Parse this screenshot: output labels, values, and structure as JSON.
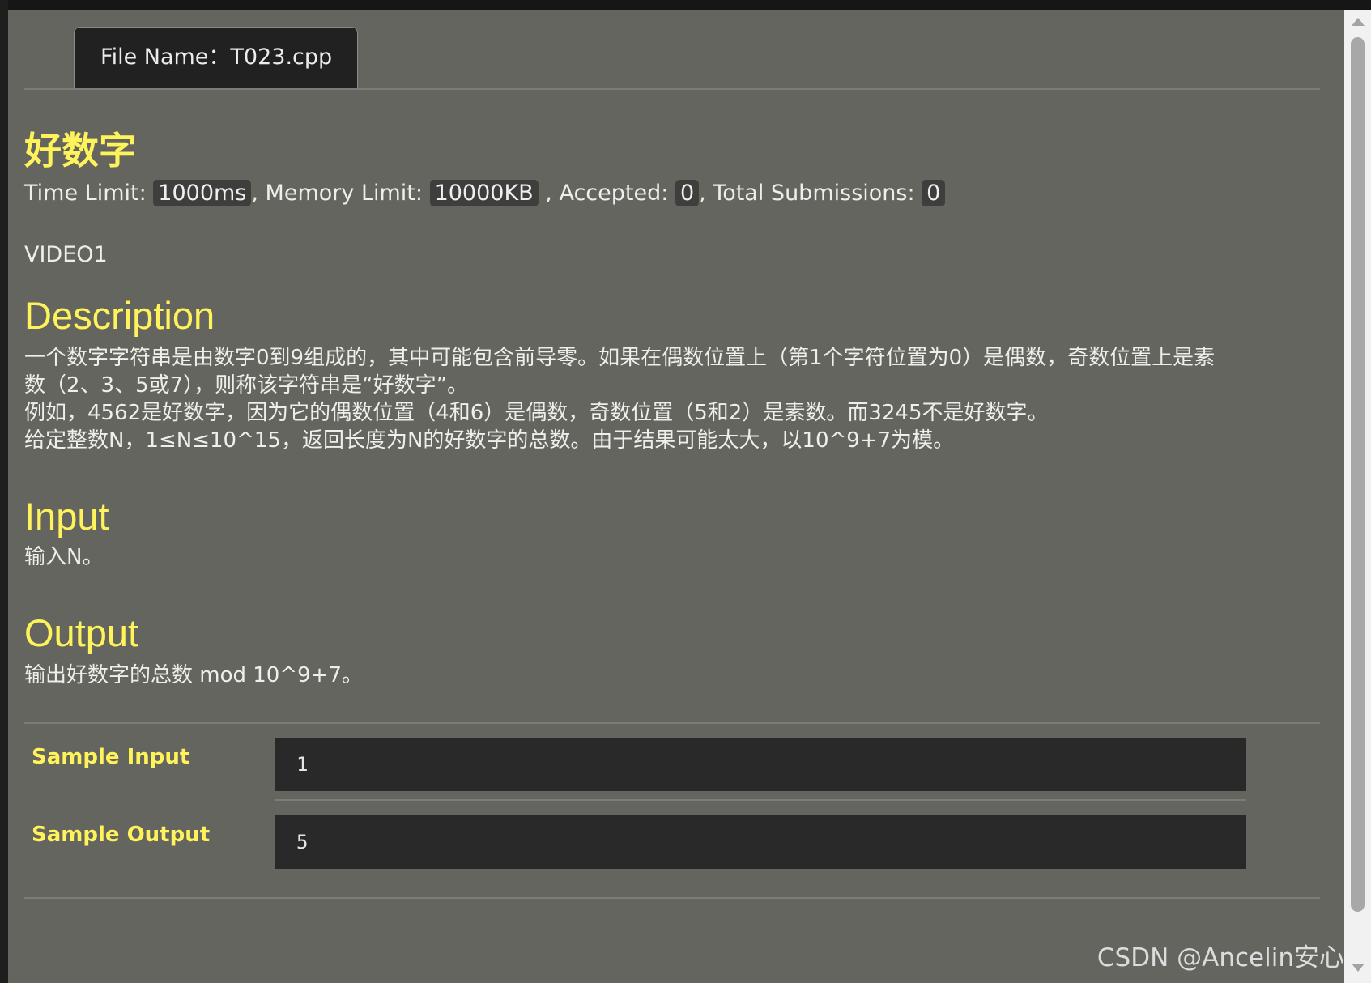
{
  "tab": {
    "file_label": "File Name：T023.cpp"
  },
  "problem": {
    "title": "好数字",
    "time_limit_label": "Time Limit:",
    "time_limit": "1000ms",
    "memory_limit_label": ", Memory Limit:",
    "memory_limit": "10000KB",
    "accepted_label": ", Accepted:",
    "accepted": "0",
    "total_label": ", Total Submissions:",
    "total": "0",
    "source": "VIDEO1"
  },
  "description": {
    "heading": "Description",
    "lines": [
      "一个数字字符串是由数字0到9组成的，其中可能包含前导零。如果在偶数位置上（第1个字符位置为0）是偶数，奇数位置上是素",
      "数（2、3、5或7），则称该字符串是“好数字”。",
      "例如，4562是好数字，因为它的偶数位置（4和6）是偶数，奇数位置（5和2）是素数。而3245不是好数字。",
      "给定整数N，1≤N≤10^15，返回长度为N的好数字的总数。由于结果可能太大，以10^9+7为模。"
    ]
  },
  "input": {
    "heading": "Input",
    "text": "输入N。"
  },
  "output": {
    "heading": "Output",
    "text": "输出好数字的总数 mod 10^9+7。"
  },
  "samples": {
    "input_label": "Sample Input",
    "input_value": "1",
    "output_label": "Sample Output",
    "output_value": "5"
  },
  "watermark": "CSDN @Ancelin安心"
}
